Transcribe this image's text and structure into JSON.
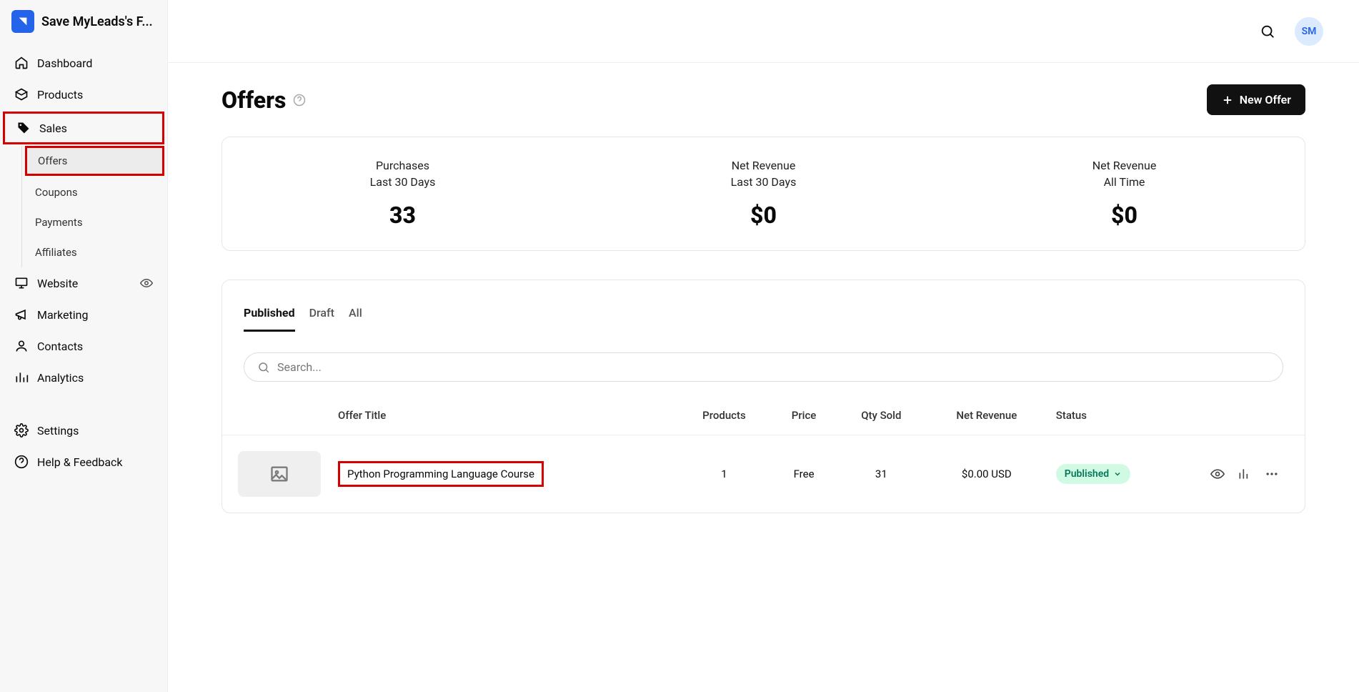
{
  "brand": {
    "title": "Save MyLeads's F..."
  },
  "sidebar": {
    "items": [
      {
        "label": "Dashboard"
      },
      {
        "label": "Products"
      },
      {
        "label": "Sales"
      },
      {
        "label": "Website"
      },
      {
        "label": "Marketing"
      },
      {
        "label": "Contacts"
      },
      {
        "label": "Analytics"
      },
      {
        "label": "Settings"
      },
      {
        "label": "Help & Feedback"
      }
    ],
    "sales_sub": [
      {
        "label": "Offers"
      },
      {
        "label": "Coupons"
      },
      {
        "label": "Payments"
      },
      {
        "label": "Affiliates"
      }
    ]
  },
  "topbar": {
    "avatar_initials": "SM"
  },
  "page": {
    "title": "Offers",
    "new_offer_label": "New Offer"
  },
  "stats": [
    {
      "title": "Purchases",
      "sub": "Last 30 Days",
      "value": "33"
    },
    {
      "title": "Net Revenue",
      "sub": "Last 30 Days",
      "value": "$0"
    },
    {
      "title": "Net Revenue",
      "sub": "All Time",
      "value": "$0"
    }
  ],
  "tabs": [
    {
      "label": "Published",
      "active": true
    },
    {
      "label": "Draft"
    },
    {
      "label": "All"
    }
  ],
  "search": {
    "placeholder": "Search..."
  },
  "table": {
    "columns": [
      "",
      "Offer Title",
      "Products",
      "Price",
      "Qty Sold",
      "Net Revenue",
      "Status",
      ""
    ],
    "rows": [
      {
        "title": "Python Programming Language Course",
        "products": "1",
        "price": "Free",
        "qty": "31",
        "net": "$0.00 USD",
        "status": "Published"
      }
    ]
  }
}
